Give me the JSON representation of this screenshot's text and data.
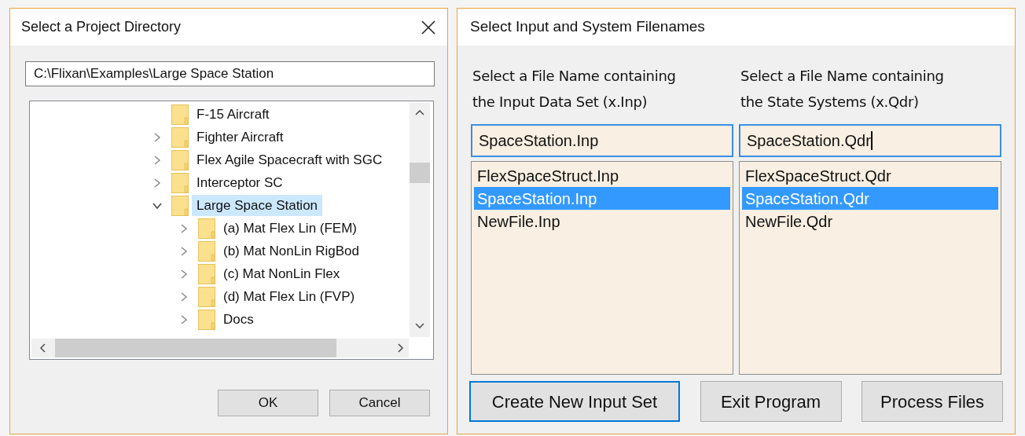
{
  "directory_dialog": {
    "title": "Select a Project Directory",
    "path": "C:\\Flixan\\Examples\\Large Space Station",
    "tree": [
      {
        "label": "F-15 Aircraft",
        "kind": "leaf",
        "selected": false
      },
      {
        "label": "Fighter Aircraft",
        "kind": "collapsed",
        "selected": false
      },
      {
        "label": "Flex Agile Spacecraft with SGC",
        "kind": "collapsed",
        "selected": false
      },
      {
        "label": "Interceptor SC",
        "kind": "collapsed",
        "selected": false
      },
      {
        "label": "Large Space Station",
        "kind": "expanded",
        "selected": true,
        "children": [
          {
            "label": "(a) Mat Flex Lin (FEM)",
            "kind": "collapsed",
            "selected": false
          },
          {
            "label": "(b) Mat NonLin RigBod",
            "kind": "collapsed",
            "selected": false
          },
          {
            "label": "(c) Mat NonLin Flex",
            "kind": "collapsed",
            "selected": false
          },
          {
            "label": "(d) Mat Flex Lin (FVP)",
            "kind": "collapsed",
            "selected": false
          },
          {
            "label": "Docs",
            "kind": "collapsed",
            "selected": false
          }
        ]
      }
    ],
    "buttons": [
      "OK",
      "Cancel"
    ]
  },
  "files_dialog": {
    "title": "Select Input and System Filenames",
    "columns": [
      {
        "heading": "Select a File Name containing the Input Data Set (x.Inp)",
        "value": "SpaceStation.Inp",
        "focused": false,
        "files": [
          {
            "name": "FlexSpaceStruct.Inp",
            "selected": false
          },
          {
            "name": "SpaceStation.Inp",
            "selected": true
          },
          {
            "name": "NewFile.Inp",
            "selected": false
          }
        ]
      },
      {
        "heading": "Select a File Name containing the State Systems (x.Qdr)",
        "value": "SpaceStation.Qdr",
        "focused": true,
        "files": [
          {
            "name": "FlexSpaceStruct.Qdr",
            "selected": false
          },
          {
            "name": "SpaceStation.Qdr",
            "selected": true
          },
          {
            "name": "NewFile.Qdr",
            "selected": false
          }
        ]
      }
    ],
    "buttons": [
      {
        "label": "Create New Input Set",
        "default": true
      },
      {
        "label": "Exit Program",
        "default": false
      },
      {
        "label": "Process Files",
        "default": false
      }
    ]
  }
}
